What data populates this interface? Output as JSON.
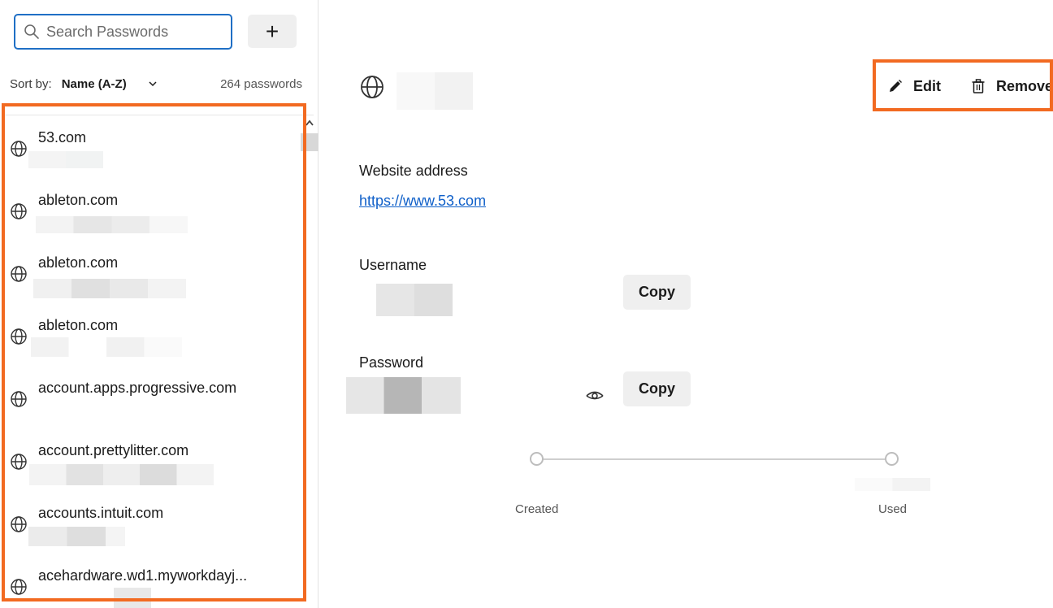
{
  "search": {
    "placeholder": "Search Passwords",
    "icon": "search-icon"
  },
  "add_button": {
    "label": "+"
  },
  "sort": {
    "label": "Sort by:",
    "value": "Name (A-Z)",
    "count": "264 passwords"
  },
  "list": {
    "items": [
      {
        "site": "53.com"
      },
      {
        "site": "ableton.com"
      },
      {
        "site": "ableton.com"
      },
      {
        "site": "ableton.com"
      },
      {
        "site": "account.apps.progressive.com"
      },
      {
        "site": "account.prettylitter.com"
      },
      {
        "site": "accounts.intuit.com"
      },
      {
        "site": "acehardware.wd1.myworkdayj..."
      }
    ]
  },
  "detail": {
    "actions": {
      "edit": "Edit",
      "remove": "Remove"
    },
    "website_label": "Website address",
    "website_url": "https://www.53.com",
    "username_label": "Username",
    "password_label": "Password",
    "copy_label": "Copy",
    "timeline": {
      "created": "Created",
      "used": "Used"
    }
  },
  "colors": {
    "accent": "#1f6fc5",
    "highlight": "#f26a21",
    "link": "#1060c9"
  }
}
